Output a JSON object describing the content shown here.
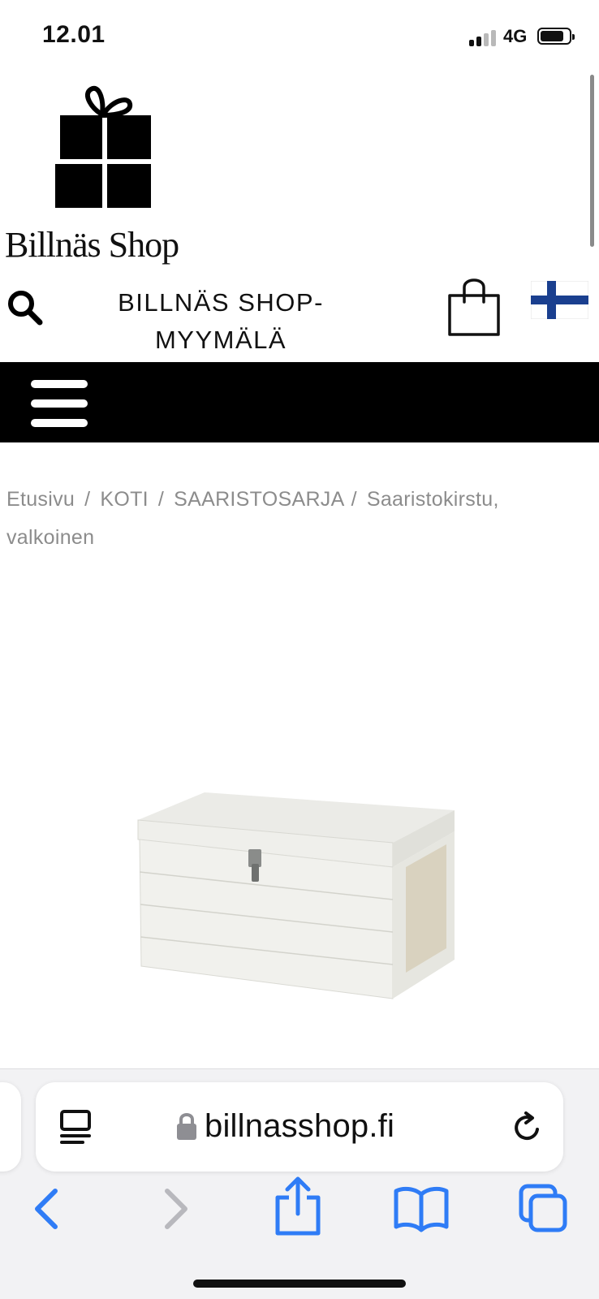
{
  "status": {
    "time": "12.01",
    "network": "4G"
  },
  "logo": {
    "text": "Billnäs Shop"
  },
  "header": {
    "title": "BILLNÄS SHOP-MYYMÄLÄ"
  },
  "breadcrumb": {
    "items": [
      "Etusivu",
      "KOTI",
      "SAARISTOSARJA",
      "Saaristokirstu, valkoinen"
    ],
    "separator": "/"
  },
  "product": {
    "image_icon": "white-wooden-chest"
  },
  "browser": {
    "url": "billnasshop.fi",
    "accent_color": "#2f7cf6"
  },
  "icons": {
    "search": "search-icon",
    "cart": "shopping-bag-icon",
    "language": "finnish-flag-icon",
    "menu": "hamburger-menu-icon"
  }
}
